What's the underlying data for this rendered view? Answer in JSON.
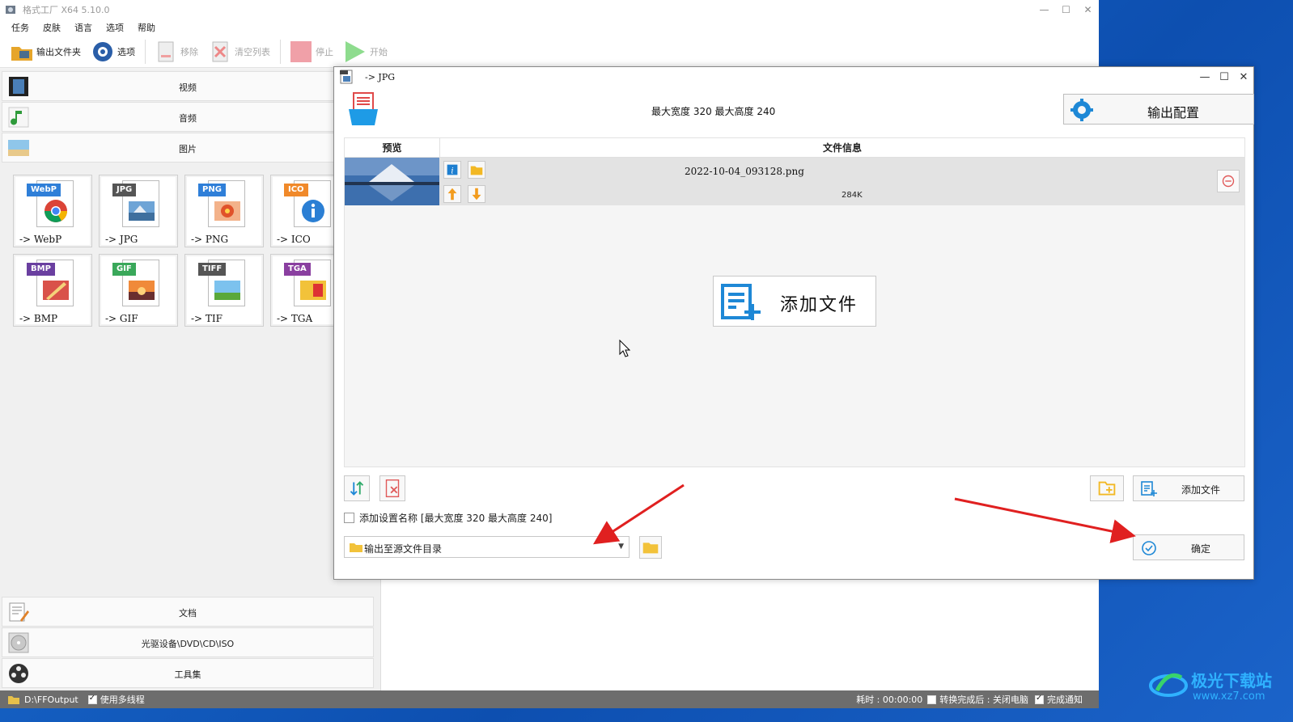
{
  "main_window": {
    "title": "格式工厂 X64 5.10.0",
    "menu": [
      "任务",
      "皮肤",
      "语言",
      "选项",
      "帮助"
    ],
    "toolbar": {
      "output_folder": "输出文件夹",
      "options": "选项",
      "remove": "移除",
      "clear_list": "清空列表",
      "stop": "停止",
      "start": "开始"
    },
    "categories": {
      "video": "视频",
      "audio": "音频",
      "image": "图片",
      "document": "文档",
      "disc": "光驱设备\\DVD\\CD\\ISO",
      "tools": "工具集"
    },
    "formats": [
      {
        "badge": "WebP",
        "caption": "-> WebP",
        "color": "#2f7fd8"
      },
      {
        "badge": "JPG",
        "caption": "-> JPG",
        "color": "#555555"
      },
      {
        "badge": "PNG",
        "caption": "-> PNG",
        "color": "#2f7fd8"
      },
      {
        "badge": "ICO",
        "caption": "-> ICO",
        "color": "#f0892a"
      },
      {
        "badge": "BMP",
        "caption": "-> BMP",
        "color": "#6a3fa0"
      },
      {
        "badge": "GIF",
        "caption": "-> GIF",
        "color": "#3aa85a"
      },
      {
        "badge": "TIFF",
        "caption": "-> TIF",
        "color": "#555555"
      },
      {
        "badge": "TGA",
        "caption": "-> TGA",
        "color": "#8a3fa0"
      }
    ],
    "status": {
      "output_path": "D:\\FFOutput",
      "multithread": "使用多线程",
      "elapsed": "耗时 : 00:00:00",
      "after_done": "转换完成后 : 关闭电脑",
      "notify": "完成通知"
    }
  },
  "dialog": {
    "title": "-> JPG",
    "size_info": "最大宽度 320 最大高度 240",
    "output_config": "输出配置",
    "columns": {
      "preview": "预览",
      "file_info": "文件信息"
    },
    "file": {
      "name": "2022-10-04_093128.png",
      "size": "284K"
    },
    "add_file_big": "添加文件",
    "add_file": "添加文件",
    "add_setting_name": "添加设置名称 [最大宽度 320 最大高度 240]",
    "output_target": "输出至源文件目录",
    "ok": "确定"
  },
  "watermark": {
    "title": "极光下载站",
    "url": "www.xz7.com"
  },
  "colors": {
    "accent": "#1e88d6",
    "arrow": "#e02020",
    "desktop": "#1a5fc4"
  }
}
